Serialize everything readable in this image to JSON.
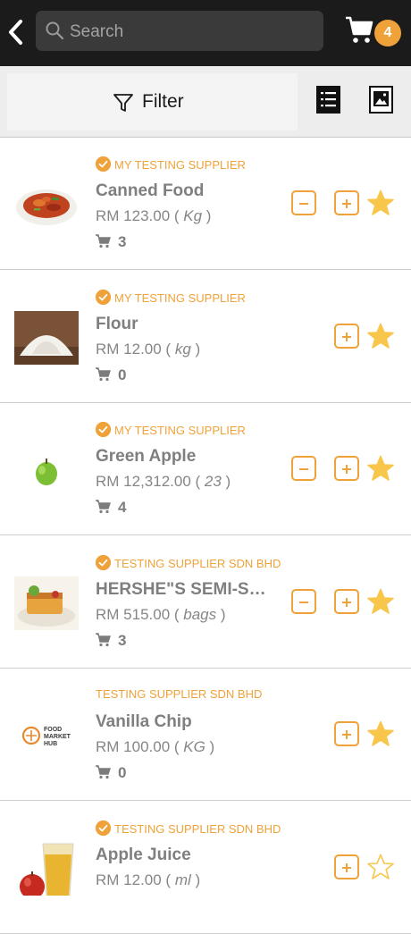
{
  "header": {
    "search_placeholder": "Search",
    "cart_count": "4"
  },
  "toolbar": {
    "filter_label": "Filter"
  },
  "colors": {
    "accent": "#f0a23a",
    "topbar": "#1b1b1b"
  },
  "products": [
    {
      "supplier": "MY TESTING SUPPLIER",
      "verified": true,
      "name": "Canned Food",
      "price": "RM 123.00 (",
      "unit": "Kg",
      "price_end": ")",
      "count": "3",
      "has_minus": true,
      "favorite": true,
      "image": "chili-chicken-dish"
    },
    {
      "supplier": "MY TESTING SUPPLIER",
      "verified": true,
      "name": "Flour",
      "price": "RM 12.00 (",
      "unit": "kg",
      "price_end": ")",
      "count": "0",
      "has_minus": false,
      "favorite": true,
      "image": "flour-pile"
    },
    {
      "supplier": "MY TESTING SUPPLIER",
      "verified": true,
      "name": "Green Apple",
      "price": "RM 12,312.00 (",
      "unit": "23",
      "price_end": ")",
      "count": "4",
      "has_minus": true,
      "favorite": true,
      "image": "green-apple"
    },
    {
      "supplier": "TESTING SUPPLIER SDN BHD",
      "verified": true,
      "name": "HERSHE\"S SEMI-SW...",
      "price": "RM 515.00 (",
      "unit": "bags",
      "price_end": ")",
      "count": "3",
      "has_minus": true,
      "favorite": true,
      "image": "dessert-plate"
    },
    {
      "supplier": "TESTING SUPPLIER SDN BHD",
      "verified": false,
      "name": "Vanilla Chip",
      "price": "RM 100.00 (",
      "unit": "KG",
      "price_end": ")",
      "count": "0",
      "has_minus": false,
      "favorite": true,
      "image": "food-market-hub-logo",
      "logo_text": [
        "FOOD",
        "MARKET",
        "HUB"
      ]
    },
    {
      "supplier": "TESTING SUPPLIER SDN BHD",
      "verified": true,
      "name": "Apple Juice",
      "price": "RM 12.00 (",
      "unit": "ml",
      "price_end": ")",
      "count": "",
      "has_minus": false,
      "favorite": false,
      "image": "apple-juice-glass"
    }
  ]
}
